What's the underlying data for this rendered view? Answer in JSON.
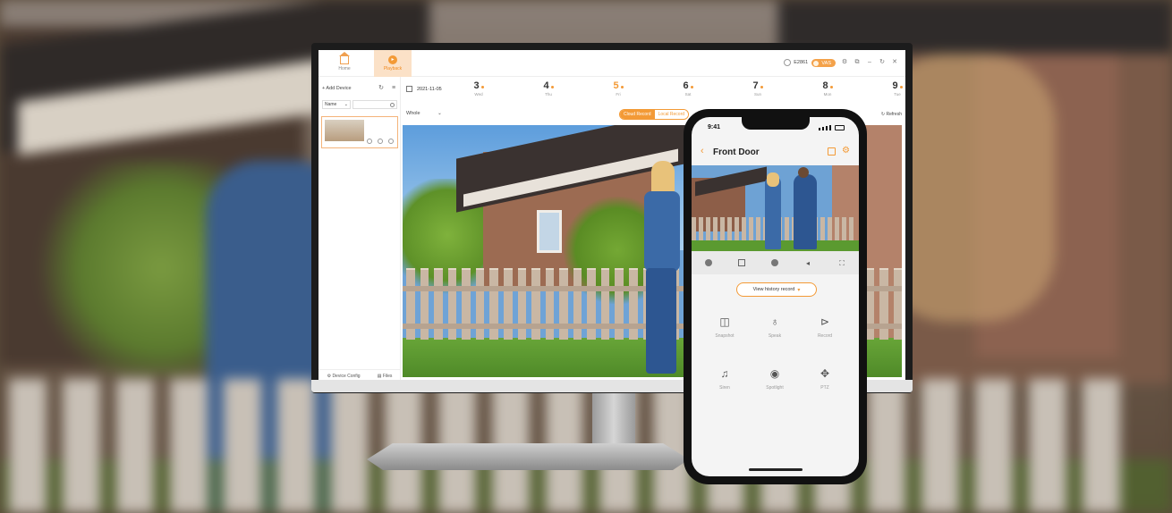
{
  "desktop": {
    "nav": {
      "home_label": "Home",
      "playback_label": "Playback"
    },
    "user": {
      "name": "E2861"
    },
    "vas_label": "VAS",
    "sidebar": {
      "add_device_label": "+ Add Device",
      "sort_select_value": "Name",
      "footer": {
        "device_config_label": "Device Config",
        "files_label": "Files"
      }
    },
    "date_strip": {
      "current_date": "2021-11-05",
      "days": [
        {
          "num": "3",
          "weekday": "Wed",
          "has_record": true,
          "active": false
        },
        {
          "num": "4",
          "weekday": "Thu",
          "has_record": true,
          "active": false
        },
        {
          "num": "5",
          "weekday": "Fri",
          "has_record": true,
          "active": true
        },
        {
          "num": "6",
          "weekday": "Sat",
          "has_record": true,
          "active": false
        },
        {
          "num": "7",
          "weekday": "Sun",
          "has_record": true,
          "active": false
        },
        {
          "num": "8",
          "weekday": "Mon",
          "has_record": true,
          "active": false
        },
        {
          "num": "9",
          "weekday": "Tue",
          "has_record": true,
          "active": false
        }
      ]
    },
    "filters": {
      "range_value": "Whole",
      "cloud_record_label": "Cloud Record",
      "local_record_label": "Local Record",
      "refresh_label": "Refresh"
    }
  },
  "phone": {
    "time": "9:41",
    "title": "Front Door",
    "history_button_label": "View  history record",
    "actions": [
      {
        "label": "Snapshot",
        "icon": "camera-icon"
      },
      {
        "label": "Speak",
        "icon": "microphone-icon"
      },
      {
        "label": "Record",
        "icon": "record-icon"
      },
      {
        "label": "Siren",
        "icon": "bell-icon"
      },
      {
        "label": "Spotlight",
        "icon": "spotlight-icon"
      },
      {
        "label": "PTZ",
        "icon": "ptz-icon"
      }
    ]
  },
  "colors": {
    "accent": "#f39a36",
    "accent_light": "#fbe1c7"
  }
}
